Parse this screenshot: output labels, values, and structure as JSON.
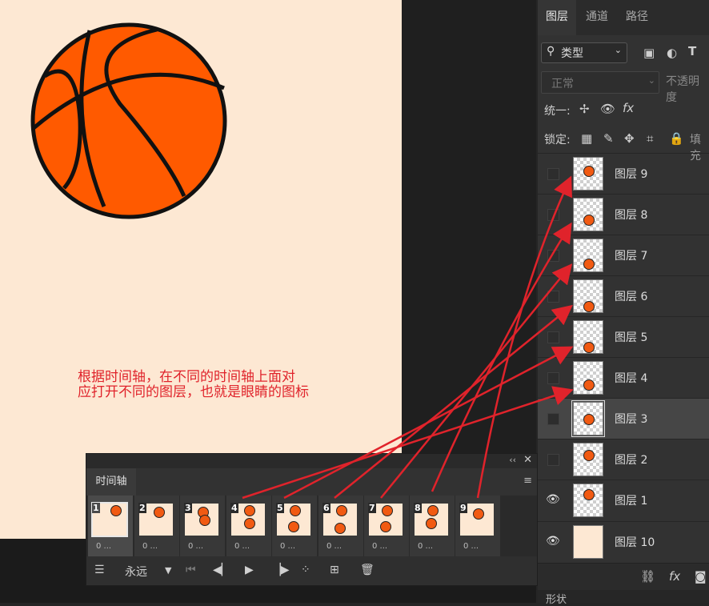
{
  "annotation": {
    "text": "根据时间轴，在不同的时间轴上面对\n应打开不同的图层，也就是眼睛的图标",
    "color": "#e0232b"
  },
  "layers_panel": {
    "tabs": [
      "图层",
      "通道",
      "路径"
    ],
    "filter_label": "类型",
    "blend_mode": "正常",
    "opacity_label": "不透明度",
    "unify_label": "统一:",
    "lock_label": "锁定:",
    "fill_label": "填充",
    "bottom_tab": "形状",
    "layers": [
      {
        "name": "图层 9",
        "visible": false
      },
      {
        "name": "图层 8",
        "visible": false
      },
      {
        "name": "图层 7",
        "visible": false
      },
      {
        "name": "图层 6",
        "visible": false
      },
      {
        "name": "图层 5",
        "visible": false
      },
      {
        "name": "图层 4",
        "visible": false
      },
      {
        "name": "图层 3",
        "visible": false,
        "selected": true
      },
      {
        "name": "图层 2",
        "visible": false
      },
      {
        "name": "图层 1",
        "visible": true
      },
      {
        "name": "图层 10",
        "visible": true
      }
    ]
  },
  "timeline": {
    "title": "时间轴",
    "loop_option": "永远",
    "frames": [
      {
        "number": "1",
        "delay": "0 ..."
      },
      {
        "number": "2",
        "delay": "0 ..."
      },
      {
        "number": "3",
        "delay": "0 ..."
      },
      {
        "number": "4",
        "delay": "0 ..."
      },
      {
        "number": "5",
        "delay": "0 ..."
      },
      {
        "number": "6",
        "delay": "0 ..."
      },
      {
        "number": "7",
        "delay": "0 ..."
      },
      {
        "number": "8",
        "delay": "0 ..."
      },
      {
        "number": "9",
        "delay": "0 ..."
      }
    ]
  },
  "colors": {
    "canvas_bg": "#fde8d3",
    "ball": "#f15a12",
    "panel": "#323232"
  }
}
